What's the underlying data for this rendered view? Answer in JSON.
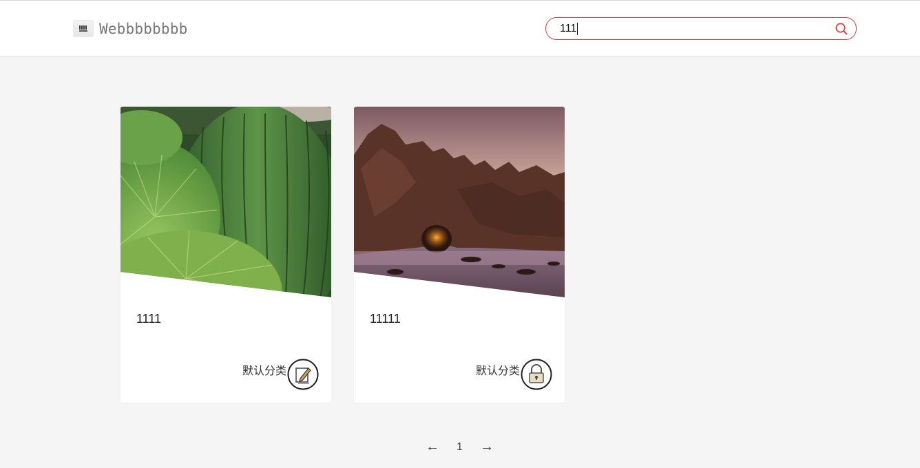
{
  "header": {
    "logo_text": "Webbbbbbbb",
    "search": {
      "value": "111",
      "icon": "search-icon"
    }
  },
  "posts": [
    {
      "title": "1111",
      "category": "默认分类",
      "image": "cactus-photo",
      "icon": "edit-icon"
    },
    {
      "title": "11111",
      "category": "默认分类",
      "image": "sea-arch-photo",
      "icon": "lock-icon"
    }
  ],
  "pagination": {
    "prev": "←",
    "current": "1",
    "next": "→"
  },
  "colors": {
    "accent": "#d9434c",
    "background": "#f5f5f5"
  }
}
